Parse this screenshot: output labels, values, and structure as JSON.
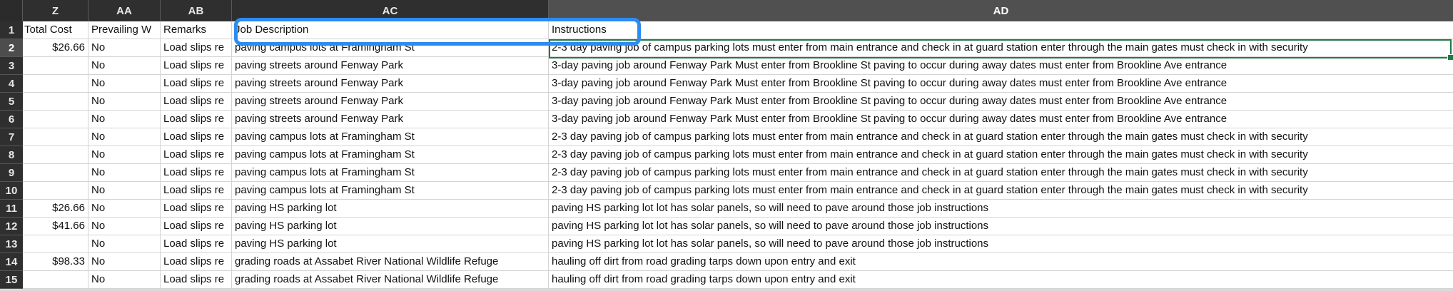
{
  "columns": [
    "Z",
    "AA",
    "AB",
    "AC",
    "AD"
  ],
  "headers": {
    "z": "Total Cost",
    "aa": "Prevailing W",
    "ab": "Remarks",
    "ac": "Job Description",
    "ad": "Instructions"
  },
  "rows": [
    {
      "n": "2",
      "z": "$26.66",
      "aa": "No",
      "ab": "Load slips re",
      "ac": "paving campus lots at Framingham St",
      "ad": "2-3 day paving job of campus parking lots must enter from main entrance and check in at guard station enter through the main gates must check in with security"
    },
    {
      "n": "3",
      "z": "",
      "aa": "No",
      "ab": "Load slips re",
      "ac": "paving streets around Fenway Park",
      "ad": "3-day paving job around Fenway Park Must enter from Brookline St paving to occur during away dates must enter from Brookline Ave entrance"
    },
    {
      "n": "4",
      "z": "",
      "aa": "No",
      "ab": "Load slips re",
      "ac": "paving streets around Fenway Park",
      "ad": "3-day paving job around Fenway Park Must enter from Brookline St paving to occur during away dates must enter from Brookline Ave entrance"
    },
    {
      "n": "5",
      "z": "",
      "aa": "No",
      "ab": "Load slips re",
      "ac": "paving streets around Fenway Park",
      "ad": "3-day paving job around Fenway Park Must enter from Brookline St paving to occur during away dates must enter from Brookline Ave entrance"
    },
    {
      "n": "6",
      "z": "",
      "aa": "No",
      "ab": "Load slips re",
      "ac": "paving streets around Fenway Park",
      "ad": "3-day paving job around Fenway Park Must enter from Brookline St paving to occur during away dates must enter from Brookline Ave entrance"
    },
    {
      "n": "7",
      "z": "",
      "aa": "No",
      "ab": "Load slips re",
      "ac": "paving campus lots at Framingham St",
      "ad": "2-3 day paving job of campus parking lots must enter from main entrance and check in at guard station enter through the main gates must check in with security"
    },
    {
      "n": "8",
      "z": "",
      "aa": "No",
      "ab": "Load slips re",
      "ac": "paving campus lots at Framingham St",
      "ad": "2-3 day paving job of campus parking lots must enter from main entrance and check in at guard station enter through the main gates must check in with security"
    },
    {
      "n": "9",
      "z": "",
      "aa": "No",
      "ab": "Load slips re",
      "ac": "paving campus lots at Framingham St",
      "ad": "2-3 day paving job of campus parking lots must enter from main entrance and check in at guard station enter through the main gates must check in with security"
    },
    {
      "n": "10",
      "z": "",
      "aa": "No",
      "ab": "Load slips re",
      "ac": "paving campus lots at Framingham St",
      "ad": "2-3 day paving job of campus parking lots must enter from main entrance and check in at guard station enter through the main gates must check in with security"
    },
    {
      "n": "11",
      "z": "$26.66",
      "aa": "No",
      "ab": "Load slips re",
      "ac": "paving HS parking lot",
      "ad": "paving HS parking lot lot has solar panels, so will need to pave around those job instructions"
    },
    {
      "n": "12",
      "z": "$41.66",
      "aa": "No",
      "ab": "Load slips re",
      "ac": "paving HS parking lot",
      "ad": "paving HS parking lot lot has solar panels, so will need to pave around those job instructions"
    },
    {
      "n": "13",
      "z": "",
      "aa": "No",
      "ab": "Load slips re",
      "ac": "paving HS parking lot",
      "ad": "paving HS parking lot lot has solar panels, so will need to pave around those job instructions"
    },
    {
      "n": "14",
      "z": "$98.33",
      "aa": "No",
      "ab": "Load slips re",
      "ac": "grading roads at Assabet River National Wildlife Refuge",
      "ad": "hauling off dirt from road grading tarps down upon entry and exit"
    },
    {
      "n": "15",
      "z": "",
      "aa": "No",
      "ab": "Load slips re",
      "ac": "grading roads at Assabet River National Wildlife Refuge",
      "ad": "hauling off dirt from road grading tarps down upon entry and exit"
    }
  ],
  "colors": {
    "header_bg": "#2f2f2f",
    "active_header_bg": "#505050",
    "selection_border": "#1e7b45",
    "highlight_border": "#2c8cf0"
  }
}
